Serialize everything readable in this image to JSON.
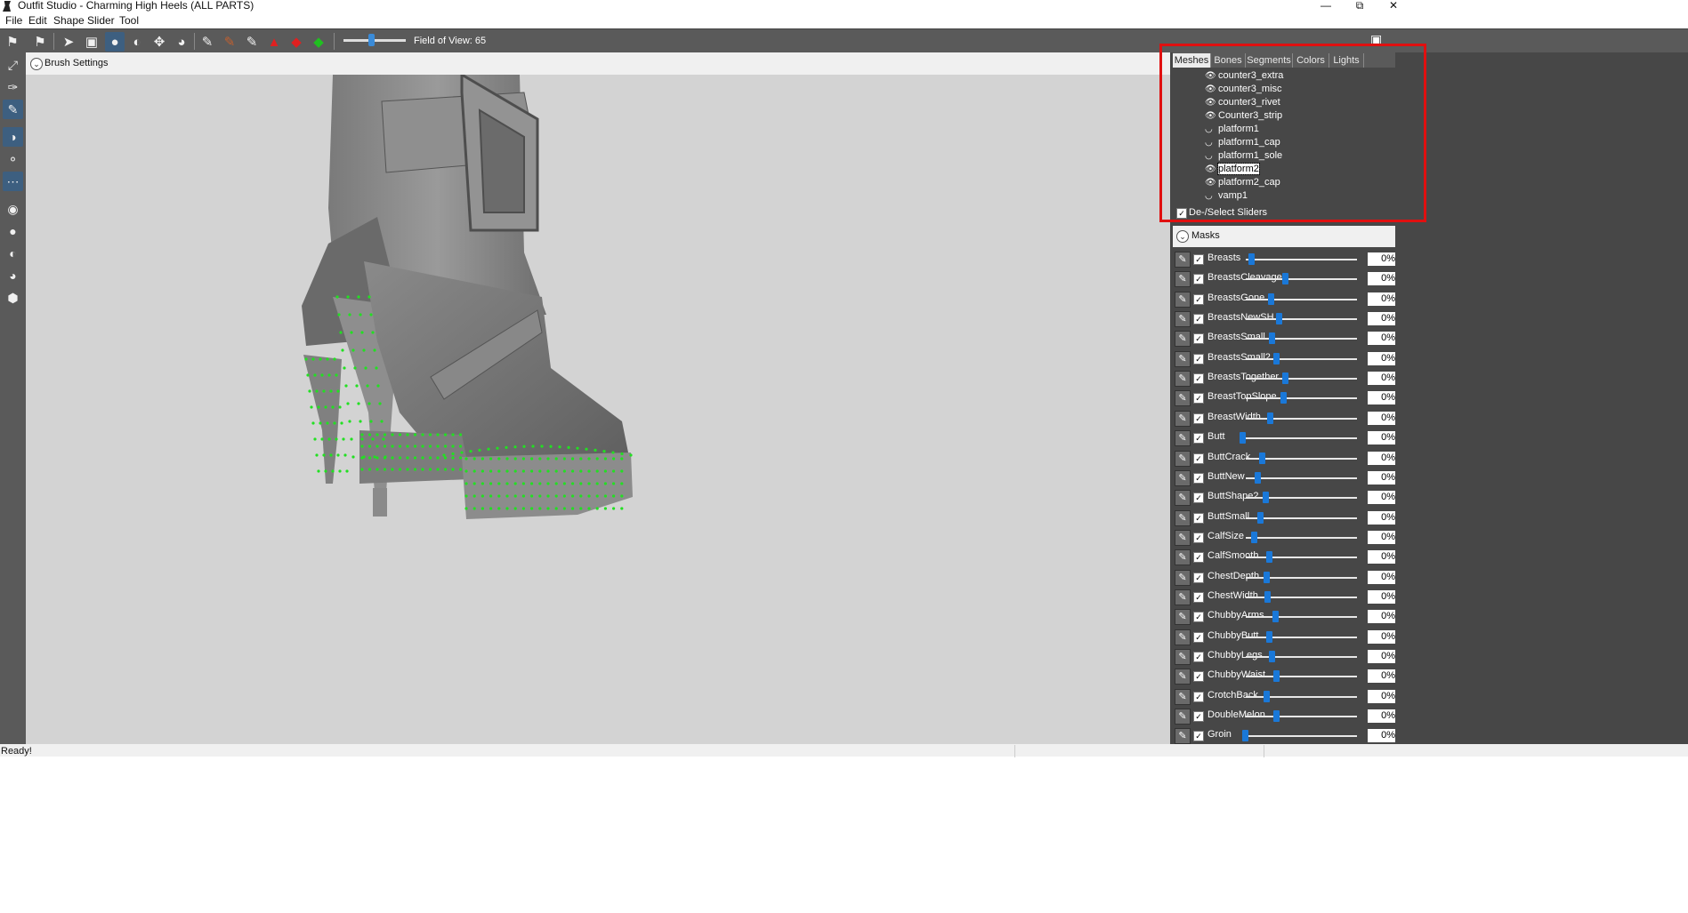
{
  "window": {
    "title": "Outfit Studio - Charming High Heels (ALL PARTS)",
    "minimize": "—",
    "restore": "⧉",
    "close": "✕"
  },
  "menu": [
    "File",
    "Edit",
    "Shape",
    "Slider",
    "Tool"
  ],
  "toolbar": {
    "icons": [
      "project-icon",
      "outfit-icon",
      "select-icon",
      "mask-icon",
      "inflate-icon",
      "deflate-icon",
      "move-icon",
      "smooth-icon",
      "weight-paint-icon",
      "color-paint-icon",
      "alpha-paint-icon",
      "collision-icon",
      "ref-icon",
      "bone-icon"
    ],
    "fov_label": "Field of View: 65",
    "fov_value": 65
  },
  "brush_settings": {
    "label": "Brush Settings"
  },
  "left_tools": [
    "move-tool-icon",
    "pin-tool-icon",
    "brush-tool-icon",
    "xmirror-icon",
    "connected-icon",
    "global-icon",
    "vertex-points-icon",
    "wireframe-icon",
    "lighting-icon",
    "texture-icon",
    "shading-icon"
  ],
  "tabs": [
    "Meshes",
    "Bones",
    "Segments",
    "Colors",
    "Lights"
  ],
  "selected_tab": "Meshes",
  "meshes": [
    {
      "name": "counter3_extra",
      "visible": true
    },
    {
      "name": "counter3_misc",
      "visible": true
    },
    {
      "name": "counter3_rivet",
      "visible": true
    },
    {
      "name": "Counter3_strip",
      "visible": true
    },
    {
      "name": "platform1",
      "visible": false
    },
    {
      "name": "platform1_cap",
      "visible": false
    },
    {
      "name": "platform1_sole",
      "visible": false
    },
    {
      "name": "platform2",
      "visible": true,
      "selected": true
    },
    {
      "name": "platform2_cap",
      "visible": true
    },
    {
      "name": "vamp1",
      "visible": false
    }
  ],
  "deselect_sliders": {
    "label": "De-/Select Sliders",
    "checked": "✓"
  },
  "masks": {
    "label": "Masks"
  },
  "sliders": [
    {
      "name": "Breasts",
      "value": "0%",
      "level": 0.02
    },
    {
      "name": "BreastsCleavage",
      "value": "0%",
      "level": 0.33
    },
    {
      "name": "BreastsGone",
      "value": "0%",
      "level": 0.2
    },
    {
      "name": "BreastsNewSH",
      "value": "0%",
      "level": 0.27
    },
    {
      "name": "BreastsSmall",
      "value": "0%",
      "level": 0.21
    },
    {
      "name": "BreastsSmall2",
      "value": "0%",
      "level": 0.25
    },
    {
      "name": "BreastsTogether",
      "value": "0%",
      "level": 0.33
    },
    {
      "name": "BreastTopSlope",
      "value": "0%",
      "level": 0.31
    },
    {
      "name": "BreastWidth",
      "value": "0%",
      "level": 0.19
    },
    {
      "name": "Butt",
      "value": "0%",
      "level": -0.06
    },
    {
      "name": "ButtCrack",
      "value": "0%",
      "level": 0.12
    },
    {
      "name": "ButtNew",
      "value": "0%",
      "level": 0.08
    },
    {
      "name": "ButtShape2",
      "value": "0%",
      "level": 0.15
    },
    {
      "name": "ButtSmall",
      "value": "0%",
      "level": 0.1
    },
    {
      "name": "CalfSize",
      "value": "0%",
      "level": 0.05
    },
    {
      "name": "CalfSmooth",
      "value": "0%",
      "level": 0.18
    },
    {
      "name": "ChestDepth",
      "value": "0%",
      "level": 0.16
    },
    {
      "name": "ChestWidth",
      "value": "0%",
      "level": 0.17
    },
    {
      "name": "ChubbyArms",
      "value": "0%",
      "level": 0.24
    },
    {
      "name": "ChubbyButt",
      "value": "0%",
      "level": 0.18
    },
    {
      "name": "ChubbyLegs",
      "value": "0%",
      "level": 0.21
    },
    {
      "name": "ChubbyWaist",
      "value": "0%",
      "level": 0.25
    },
    {
      "name": "CrotchBack",
      "value": "0%",
      "level": 0.16
    },
    {
      "name": "DoubleMelon",
      "value": "0%",
      "level": 0.25
    },
    {
      "name": "Groin",
      "value": "0%",
      "level": -0.03
    }
  ],
  "status": {
    "text": "Ready!"
  },
  "colors": {
    "viewport": "#d3d3d3",
    "vertex_points": "#22e022",
    "highlight": "#e01010",
    "slider_thumb": "#1a78d8"
  }
}
